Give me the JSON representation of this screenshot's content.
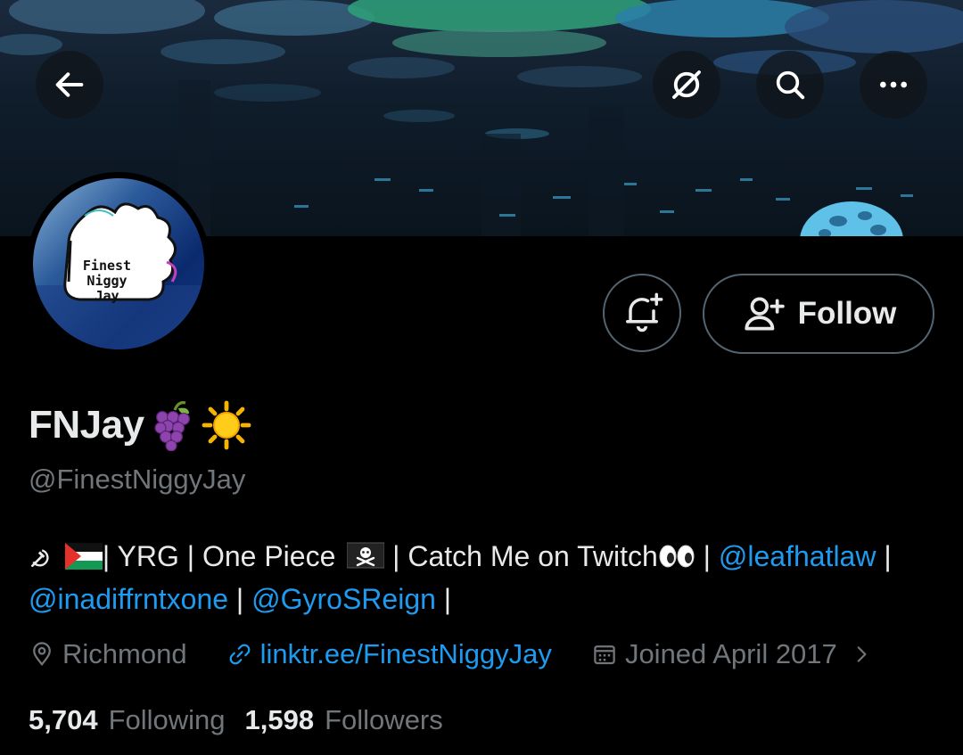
{
  "header": {
    "back_icon": "arrow-left-icon",
    "grok_icon": "grok-icon",
    "search_icon": "search-icon",
    "more_icon": "more-horizontal-icon"
  },
  "avatar": {
    "lines": [
      "Finest",
      "Niggy",
      "Jay"
    ]
  },
  "actions": {
    "notify_icon": "bell-plus-icon",
    "follow_label": "Follow"
  },
  "profile": {
    "display_name": "FNJay",
    "name_emojis": [
      "grapes-emoji",
      "sun-emoji"
    ],
    "handle": "@FinestNiggyJay",
    "bio": {
      "t1": "| YRG | One Piece",
      "t2": "| Catch Me on Twitch",
      "sep": "|",
      "mention1": "@leafhatlaw",
      "mention2": "@inadiffrntxone",
      "mention3": "@GyroSReign",
      "icons": [
        "hammer-sickle-icon",
        "palestine-flag-icon",
        "pirate-flag-icon",
        "eyes-emoji"
      ]
    },
    "location": "Richmond",
    "website": "linktr.ee/FinestNiggyJay",
    "joined": "Joined April 2017"
  },
  "stats": {
    "following_count": "5,704",
    "following_label": "Following",
    "followers_count": "1,598",
    "followers_label": "Followers"
  },
  "colors": {
    "background": "#000000",
    "text": "#e7e9ea",
    "secondary": "#71767b",
    "link": "#1d9bf0",
    "border": "#536471"
  }
}
